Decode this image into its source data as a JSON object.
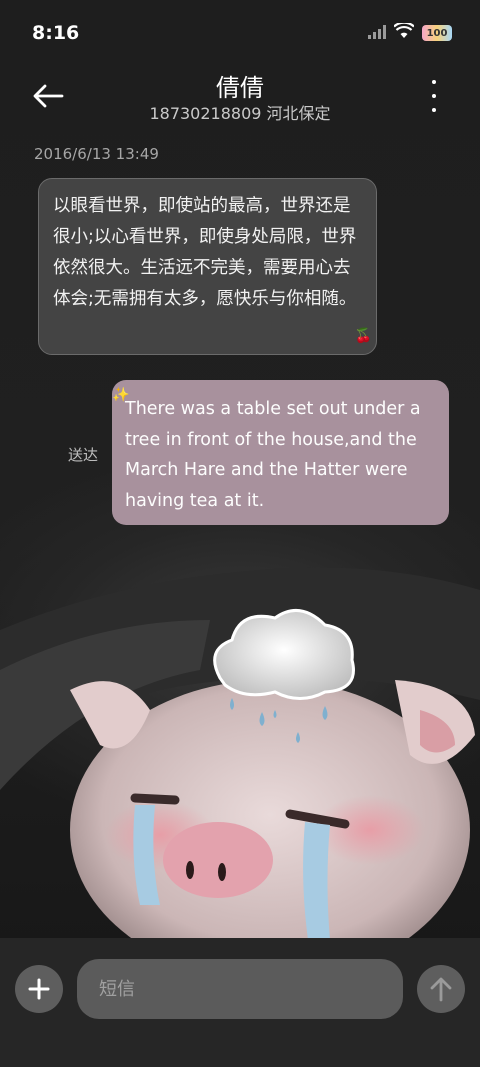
{
  "status_bar": {
    "time": "8:16",
    "battery": "100",
    "icons": [
      "signal-icon",
      "wifi-icon",
      "battery-icon"
    ]
  },
  "header": {
    "contact_name": "倩倩",
    "contact_info": "18730218809 河北保定",
    "back_icon": "back-arrow-icon",
    "menu_icon": "more-vertical-icon"
  },
  "conversation": {
    "timestamp": "2016/6/13 13:49",
    "messages": [
      {
        "direction": "incoming",
        "text": "以眼看世界，即使站的最高，世界还是很小;以心看世界，即使身处局限，世界依然很大。生活远不完美，需要用心去体会;无需拥有太多，愿快乐与你相随。",
        "sticker": "cherry-icon"
      },
      {
        "direction": "outgoing",
        "status": "送达",
        "text": "There was a table set out under a tree in front of the house,and the March Hare and the Hatter were having tea at it.",
        "sticker": "sparkle-icon"
      }
    ]
  },
  "compose": {
    "placeholder": "短信",
    "add_icon": "plus-icon",
    "send_icon": "send-arrow-icon"
  },
  "colors": {
    "background": "#1c1c1c",
    "incoming_bubble": "#484848",
    "outgoing_bubble": "#a8919d",
    "compose_bar": "#262626"
  }
}
